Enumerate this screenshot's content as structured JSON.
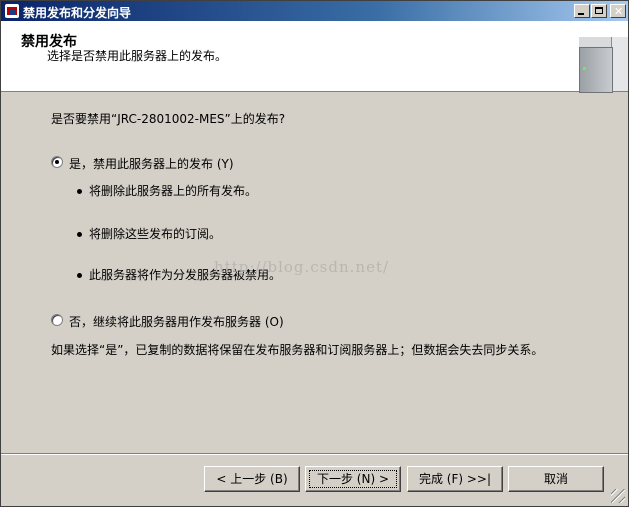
{
  "window": {
    "title": "禁用发布和分发向导",
    "icon": "wizard-app-icon",
    "controls": [
      "minimize",
      "maximize",
      "close"
    ]
  },
  "header": {
    "title": "禁用发布",
    "subtitle": "选择是否禁用此服务器上的发布。",
    "image": "server-tower-icon"
  },
  "main": {
    "question": "是否要禁用“JRC-2801002-MES”上的发布?",
    "option_yes": {
      "label": "是，禁用此服务器上的发布 (Y)",
      "selected": true,
      "bullets": [
        "将删除此服务器上的所有发布。",
        "将删除这些发布的订阅。",
        "此服务器将作为分发服务器被禁用。"
      ]
    },
    "option_no": {
      "label": "否，继续将此服务器用作发布服务器 (O)",
      "selected": false
    },
    "note": "如果选择“是”，已复制的数据将保留在发布服务器和订阅服务器上；但数据会失去同步关系。",
    "watermark": "http://blog.csdn.net/"
  },
  "footer": {
    "back_label": "< 上一步 (B)",
    "next_label": "下一步 (N) >",
    "finish_label": "完成 (F) >>|",
    "cancel_label": "取消"
  }
}
